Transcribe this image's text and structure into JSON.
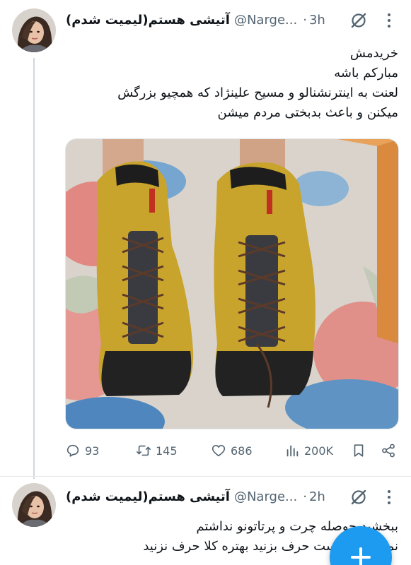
{
  "tweet1": {
    "display_name": "(لیمیت شدم)آتیشی هستم",
    "handle": "@Narge...",
    "separator": "·",
    "time": "3h",
    "text": "خریدمش\nمبارکم باشه\nلعنت به اینترنشنالو و مسیح علینژاد که همچیو بزرگش\nمیکنن و باعث بدبختی مردم میشن",
    "media_alt": "photo",
    "stats": {
      "replies": "93",
      "reposts": "145",
      "likes": "686",
      "views": "200K"
    }
  },
  "tweet2": {
    "display_name": "(لیمیت شدم)آتیشی هستم",
    "handle": "@Narge...",
    "separator": "·",
    "time": "2h",
    "text": "ببخشید حوصله چرت و پرتاتونو نداشتم\nنمی‌تونید درست حرف بزنید بهتره کلا حرف نزنید"
  },
  "icons": {
    "grok": "grok-icon",
    "more": "more-vertical-icon",
    "reply": "reply-icon",
    "repost": "repost-icon",
    "like": "heart-icon",
    "views": "views-icon",
    "bookmark": "bookmark-icon",
    "share": "share-icon",
    "compose": "plus-icon"
  },
  "colors": {
    "accent": "#1d9bf0",
    "muted": "#536471",
    "text": "#0f1419"
  }
}
